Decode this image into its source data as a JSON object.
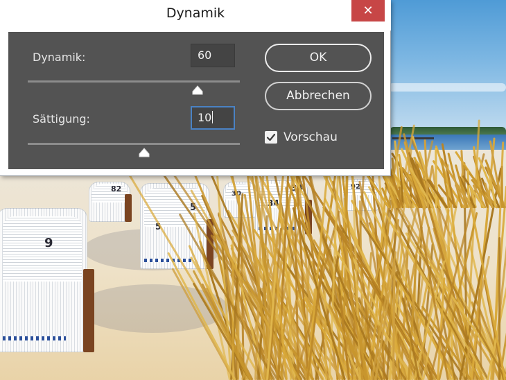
{
  "dialog": {
    "title": "Dynamik",
    "close_icon": "close-icon"
  },
  "fields": {
    "vibrance": {
      "label": "Dynamik:",
      "value": "60",
      "slider_fraction": 0.8
    },
    "saturation": {
      "label": "Sättigung:",
      "value": "10",
      "slider_fraction": 0.55
    }
  },
  "buttons": {
    "ok_label": "OK",
    "cancel_label": "Abbrechen"
  },
  "preview": {
    "label": "Vorschau",
    "checked": true
  },
  "background": {
    "chair_numbers": [
      "82",
      "30",
      "34",
      "92",
      "9",
      "5",
      "5",
      "34"
    ]
  },
  "colors": {
    "panel": "#535353",
    "close_button": "#c74646",
    "focus_ring": "#4a82c4"
  }
}
